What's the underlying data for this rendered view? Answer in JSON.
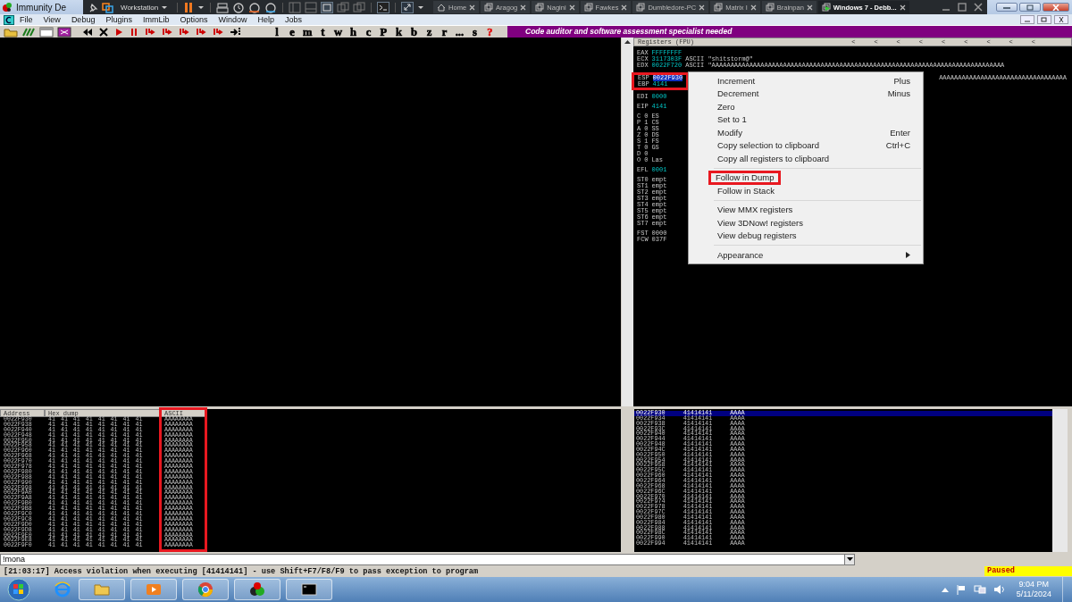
{
  "window": {
    "title": "Immunity De"
  },
  "vm_toolbar": {
    "workspace": "Workstation",
    "tabs": [
      {
        "label": "Home",
        "kind": "home",
        "selected": false
      },
      {
        "label": "Aragog",
        "kind": "vm",
        "selected": false
      },
      {
        "label": "Nagini",
        "kind": "vm",
        "selected": false
      },
      {
        "label": "Fawkes",
        "kind": "vm",
        "selected": false
      },
      {
        "label": "Dumbledore-PC",
        "kind": "vm",
        "selected": false
      },
      {
        "label": "Matrix I",
        "kind": "vm",
        "selected": false
      },
      {
        "label": "Brainpan",
        "kind": "vm",
        "selected": false
      },
      {
        "label": "Windows 7 - Debb...",
        "kind": "running",
        "selected": true
      }
    ]
  },
  "menu": [
    "File",
    "View",
    "Debug",
    "Plugins",
    "ImmLib",
    "Options",
    "Window",
    "Help",
    "Jobs"
  ],
  "toolbar_letters": [
    {
      "text": "l",
      "color": "#000000"
    },
    {
      "text": "e",
      "color": "#000000"
    },
    {
      "text": "m",
      "color": "#000000"
    },
    {
      "text": "t",
      "color": "#000000"
    },
    {
      "text": "w",
      "color": "#000000"
    },
    {
      "text": "h",
      "color": "#000000"
    },
    {
      "text": "c",
      "color": "#000000"
    },
    {
      "text": "P",
      "color": "#000000"
    },
    {
      "text": "k",
      "color": "#000000"
    },
    {
      "text": "b",
      "color": "#000000"
    },
    {
      "text": "z",
      "color": "#000000"
    },
    {
      "text": "r",
      "color": "#000000"
    },
    {
      "text": "...",
      "color": "#000000"
    },
    {
      "text": "s",
      "color": "#000000"
    },
    {
      "text": "?",
      "color": "#e01010"
    }
  ],
  "banner": "Code auditor and software assessment specialist needed",
  "registers": {
    "title": "Registers (FPU)",
    "header_arrows": [
      "<",
      "<",
      "<",
      "<",
      "<",
      "<",
      "<",
      "<",
      "<"
    ],
    "groups": [
      {
        "kind": "register",
        "rows": [
          {
            "name": "EAX",
            "value": "FFFFFFFF",
            "selected": false,
            "highlighted": false
          },
          {
            "name": "ECX",
            "value": "3117303F",
            "comment": "ASCII \"shitstorm@\"",
            "selected": false,
            "highlighted": false
          },
          {
            "name": "EDX",
            "value": "0022F720",
            "comment": "ASCII \"AAAAAAAAAAAAAAAAAAAAAAAAAAAAAAAAAAAAAAAAAAAAAAAAAAAAAAAAAAAAAAAAAAAAAAAAAAAAAA",
            "selected": false,
            "highlighted": false
          }
        ]
      },
      {
        "kind": "register",
        "rows": [
          {
            "name": "ESP",
            "value": "0022F930",
            "comment": "AAAAAAAAAAAAAAAAAAAAAAAAAAAAAAAAAA",
            "selected": true,
            "highlighted": true
          },
          {
            "name": "EBP",
            "value": "4141",
            "selected": false,
            "highlighted": true
          }
        ]
      },
      {
        "kind": "register",
        "rows": [
          {
            "name": "EDI",
            "value": "0000",
            "selected": false,
            "highlighted": false
          }
        ]
      },
      {
        "kind": "register",
        "rows": [
          {
            "name": "EIP",
            "value": "4141",
            "selected": false,
            "highlighted": false
          }
        ]
      },
      {
        "kind": "flag",
        "rows": [
          {
            "name": "C",
            "value": "0",
            "comment": "ES",
            "selected": false,
            "highlighted": false
          },
          {
            "name": "P",
            "value": "1",
            "comment": "CS",
            "selected": false,
            "highlighted": false
          },
          {
            "name": "A",
            "value": "0",
            "comment": "SS",
            "selected": false,
            "highlighted": false
          },
          {
            "name": "Z",
            "value": "0",
            "comment": "DS",
            "selected": false,
            "highlighted": false
          },
          {
            "name": "S",
            "value": "1",
            "comment": "FS",
            "selected": false,
            "highlighted": false
          },
          {
            "name": "T",
            "value": "0",
            "comment": "GS",
            "selected": false,
            "highlighted": false
          },
          {
            "name": "D",
            "value": "0",
            "selected": false,
            "highlighted": false
          },
          {
            "name": "O",
            "value": "0",
            "comment": "Las",
            "selected": false,
            "highlighted": false
          }
        ]
      },
      {
        "kind": "register",
        "rows": [
          {
            "name": "EFL",
            "value": "0001",
            "selected": false,
            "highlighted": false
          }
        ]
      },
      {
        "kind": "fpu",
        "rows": [
          {
            "name": "ST0",
            "value": "empt",
            "selected": false,
            "highlighted": false
          },
          {
            "name": "ST1",
            "value": "empt",
            "selected": false,
            "highlighted": false
          },
          {
            "name": "ST2",
            "value": "empt",
            "selected": false,
            "highlighted": false
          },
          {
            "name": "ST3",
            "value": "empt",
            "selected": false,
            "highlighted": false
          },
          {
            "name": "ST4",
            "value": "empt",
            "selected": false,
            "highlighted": false
          },
          {
            "name": "ST5",
            "value": "empt",
            "selected": false,
            "highlighted": false
          },
          {
            "name": "ST6",
            "value": "empt",
            "selected": false,
            "highlighted": false
          },
          {
            "name": "ST7",
            "value": "empt",
            "selected": false,
            "highlighted": false
          }
        ]
      },
      {
        "kind": "fpu",
        "rows": [
          {
            "name": "FST",
            "value": "0000",
            "selected": false,
            "highlighted": false
          },
          {
            "name": "FCW",
            "value": "037F",
            "selected": false,
            "highlighted": false
          }
        ]
      }
    ]
  },
  "context_menu": {
    "groups": [
      [
        {
          "label": "Increment",
          "shortcut": "Plus",
          "has_submenu": false,
          "highlighted": false
        },
        {
          "label": "Decrement",
          "shortcut": "Minus",
          "has_submenu": false,
          "highlighted": false
        },
        {
          "label": "Zero",
          "has_submenu": false,
          "highlighted": false
        },
        {
          "label": "Set to 1",
          "has_submenu": false,
          "highlighted": false
        },
        {
          "label": "Modify",
          "shortcut": "Enter",
          "has_submenu": false,
          "highlighted": false
        },
        {
          "label": "Copy selection to clipboard",
          "shortcut": "Ctrl+C",
          "has_submenu": false,
          "highlighted": false
        },
        {
          "label": "Copy all registers to clipboard",
          "has_submenu": false,
          "highlighted": false
        }
      ],
      [
        {
          "label": "Follow in Dump",
          "has_submenu": false,
          "highlighted": true
        },
        {
          "label": "Follow in Stack",
          "has_submenu": false,
          "highlighted": false
        }
      ],
      [
        {
          "label": "View MMX registers",
          "has_submenu": false,
          "highlighted": false
        },
        {
          "label": "View 3DNow! registers",
          "has_submenu": false,
          "highlighted": false
        },
        {
          "label": "View debug registers",
          "has_submenu": false,
          "highlighted": false
        }
      ],
      [
        {
          "label": "Appearance",
          "has_submenu": true,
          "highlighted": false
        }
      ]
    ]
  },
  "dump": {
    "columns": [
      {
        "label": "Address",
        "highlighted": false
      },
      {
        "label": "Hex dump",
        "highlighted": false
      },
      {
        "label": "ASCII",
        "highlighted": true
      }
    ],
    "rows": [
      {
        "address": "0022F930",
        "bytes": [
          "41",
          "41",
          "41",
          "41",
          "41",
          "41",
          "41",
          "41"
        ],
        "ascii": "AAAAAAAA"
      },
      {
        "address": "0022F938",
        "bytes": [
          "41",
          "41",
          "41",
          "41",
          "41",
          "41",
          "41",
          "41"
        ],
        "ascii": "AAAAAAAA"
      },
      {
        "address": "0022F940",
        "bytes": [
          "41",
          "41",
          "41",
          "41",
          "41",
          "41",
          "41",
          "41"
        ],
        "ascii": "AAAAAAAA"
      },
      {
        "address": "0022F948",
        "bytes": [
          "41",
          "41",
          "41",
          "41",
          "41",
          "41",
          "41",
          "41"
        ],
        "ascii": "AAAAAAAA"
      },
      {
        "address": "0022F950",
        "bytes": [
          "41",
          "41",
          "41",
          "41",
          "41",
          "41",
          "41",
          "41"
        ],
        "ascii": "AAAAAAAA"
      },
      {
        "address": "0022F958",
        "bytes": [
          "41",
          "41",
          "41",
          "41",
          "41",
          "41",
          "41",
          "41"
        ],
        "ascii": "AAAAAAAA"
      },
      {
        "address": "0022F960",
        "bytes": [
          "41",
          "41",
          "41",
          "41",
          "41",
          "41",
          "41",
          "41"
        ],
        "ascii": "AAAAAAAA"
      },
      {
        "address": "0022F968",
        "bytes": [
          "41",
          "41",
          "41",
          "41",
          "41",
          "41",
          "41",
          "41"
        ],
        "ascii": "AAAAAAAA"
      },
      {
        "address": "0022F970",
        "bytes": [
          "41",
          "41",
          "41",
          "41",
          "41",
          "41",
          "41",
          "41"
        ],
        "ascii": "AAAAAAAA"
      },
      {
        "address": "0022F978",
        "bytes": [
          "41",
          "41",
          "41",
          "41",
          "41",
          "41",
          "41",
          "41"
        ],
        "ascii": "AAAAAAAA"
      },
      {
        "address": "0022F980",
        "bytes": [
          "41",
          "41",
          "41",
          "41",
          "41",
          "41",
          "41",
          "41"
        ],
        "ascii": "AAAAAAAA"
      },
      {
        "address": "0022F988",
        "bytes": [
          "41",
          "41",
          "41",
          "41",
          "41",
          "41",
          "41",
          "41"
        ],
        "ascii": "AAAAAAAA"
      },
      {
        "address": "0022F990",
        "bytes": [
          "41",
          "41",
          "41",
          "41",
          "41",
          "41",
          "41",
          "41"
        ],
        "ascii": "AAAAAAAA"
      },
      {
        "address": "0022F998",
        "bytes": [
          "41",
          "41",
          "41",
          "41",
          "41",
          "41",
          "41",
          "41"
        ],
        "ascii": "AAAAAAAA"
      },
      {
        "address": "0022F9A0",
        "bytes": [
          "41",
          "41",
          "41",
          "41",
          "41",
          "41",
          "41",
          "41"
        ],
        "ascii": "AAAAAAAA"
      },
      {
        "address": "0022F9A8",
        "bytes": [
          "41",
          "41",
          "41",
          "41",
          "41",
          "41",
          "41",
          "41"
        ],
        "ascii": "AAAAAAAA"
      },
      {
        "address": "0022F9B0",
        "bytes": [
          "41",
          "41",
          "41",
          "41",
          "41",
          "41",
          "41",
          "41"
        ],
        "ascii": "AAAAAAAA"
      },
      {
        "address": "0022F9B8",
        "bytes": [
          "41",
          "41",
          "41",
          "41",
          "41",
          "41",
          "41",
          "41"
        ],
        "ascii": "AAAAAAAA"
      },
      {
        "address": "0022F9C0",
        "bytes": [
          "41",
          "41",
          "41",
          "41",
          "41",
          "41",
          "41",
          "41"
        ],
        "ascii": "AAAAAAAA"
      },
      {
        "address": "0022F9C8",
        "bytes": [
          "41",
          "41",
          "41",
          "41",
          "41",
          "41",
          "41",
          "41"
        ],
        "ascii": "AAAAAAAA"
      },
      {
        "address": "0022F9D0",
        "bytes": [
          "41",
          "41",
          "41",
          "41",
          "41",
          "41",
          "41",
          "41"
        ],
        "ascii": "AAAAAAAA"
      },
      {
        "address": "0022F9D8",
        "bytes": [
          "41",
          "41",
          "41",
          "41",
          "41",
          "41",
          "41",
          "41"
        ],
        "ascii": "AAAAAAAA"
      },
      {
        "address": "0022F9E0",
        "bytes": [
          "41",
          "41",
          "41",
          "41",
          "41",
          "41",
          "41",
          "41"
        ],
        "ascii": "AAAAAAAA"
      },
      {
        "address": "0022F9E8",
        "bytes": [
          "41",
          "41",
          "41",
          "41",
          "41",
          "41",
          "41",
          "41"
        ],
        "ascii": "AAAAAAAA"
      },
      {
        "address": "0022F9F0",
        "bytes": [
          "41",
          "41",
          "41",
          "41",
          "41",
          "41",
          "41",
          "41"
        ],
        "ascii": "AAAAAAAA"
      }
    ]
  },
  "stack": {
    "rows": [
      {
        "address": "0022F930",
        "value": "41414141",
        "comment": "AAAA",
        "selected": true
      },
      {
        "address": "0022F934",
        "value": "41414141",
        "comment": "AAAA",
        "selected": false
      },
      {
        "address": "0022F938",
        "value": "41414141",
        "comment": "AAAA",
        "selected": false
      },
      {
        "address": "0022F93C",
        "value": "41414141",
        "comment": "AAAA",
        "selected": false
      },
      {
        "address": "0022F940",
        "value": "41414141",
        "comment": "AAAA",
        "selected": false
      },
      {
        "address": "0022F944",
        "value": "41414141",
        "comment": "AAAA",
        "selected": false
      },
      {
        "address": "0022F948",
        "value": "41414141",
        "comment": "AAAA",
        "selected": false
      },
      {
        "address": "0022F94C",
        "value": "41414141",
        "comment": "AAAA",
        "selected": false
      },
      {
        "address": "0022F950",
        "value": "41414141",
        "comment": "AAAA",
        "selected": false
      },
      {
        "address": "0022F954",
        "value": "41414141",
        "comment": "AAAA",
        "selected": false
      },
      {
        "address": "0022F958",
        "value": "41414141",
        "comment": "AAAA",
        "selected": false
      },
      {
        "address": "0022F95C",
        "value": "41414141",
        "comment": "AAAA",
        "selected": false
      },
      {
        "address": "0022F960",
        "value": "41414141",
        "comment": "AAAA",
        "selected": false
      },
      {
        "address": "0022F964",
        "value": "41414141",
        "comment": "AAAA",
        "selected": false
      },
      {
        "address": "0022F968",
        "value": "41414141",
        "comment": "AAAA",
        "selected": false
      },
      {
        "address": "0022F96C",
        "value": "41414141",
        "comment": "AAAA",
        "selected": false
      },
      {
        "address": "0022F970",
        "value": "41414141",
        "comment": "AAAA",
        "selected": false
      },
      {
        "address": "0022F974",
        "value": "41414141",
        "comment": "AAAA",
        "selected": false
      },
      {
        "address": "0022F978",
        "value": "41414141",
        "comment": "AAAA",
        "selected": false
      },
      {
        "address": "0022F97C",
        "value": "41414141",
        "comment": "AAAA",
        "selected": false
      },
      {
        "address": "0022F980",
        "value": "41414141",
        "comment": "AAAA",
        "selected": false
      },
      {
        "address": "0022F984",
        "value": "41414141",
        "comment": "AAAA",
        "selected": false
      },
      {
        "address": "0022F988",
        "value": "41414141",
        "comment": "AAAA",
        "selected": false
      },
      {
        "address": "0022F98C",
        "value": "41414141",
        "comment": "AAAA",
        "selected": false
      },
      {
        "address": "0022F990",
        "value": "41414141",
        "comment": "AAAA",
        "selected": false
      },
      {
        "address": "0022F994",
        "value": "41414141",
        "comment": "AAAA",
        "selected": false
      }
    ]
  },
  "command": {
    "value": "!mona"
  },
  "status_bar": {
    "message": "[21:03:17] Access violation when executing [41414141] - use Shift+F7/F8/F9 to pass exception to program",
    "state": "Paused"
  },
  "taskbar": {
    "time": "9:04 PM",
    "date": "5/11/2024"
  }
}
